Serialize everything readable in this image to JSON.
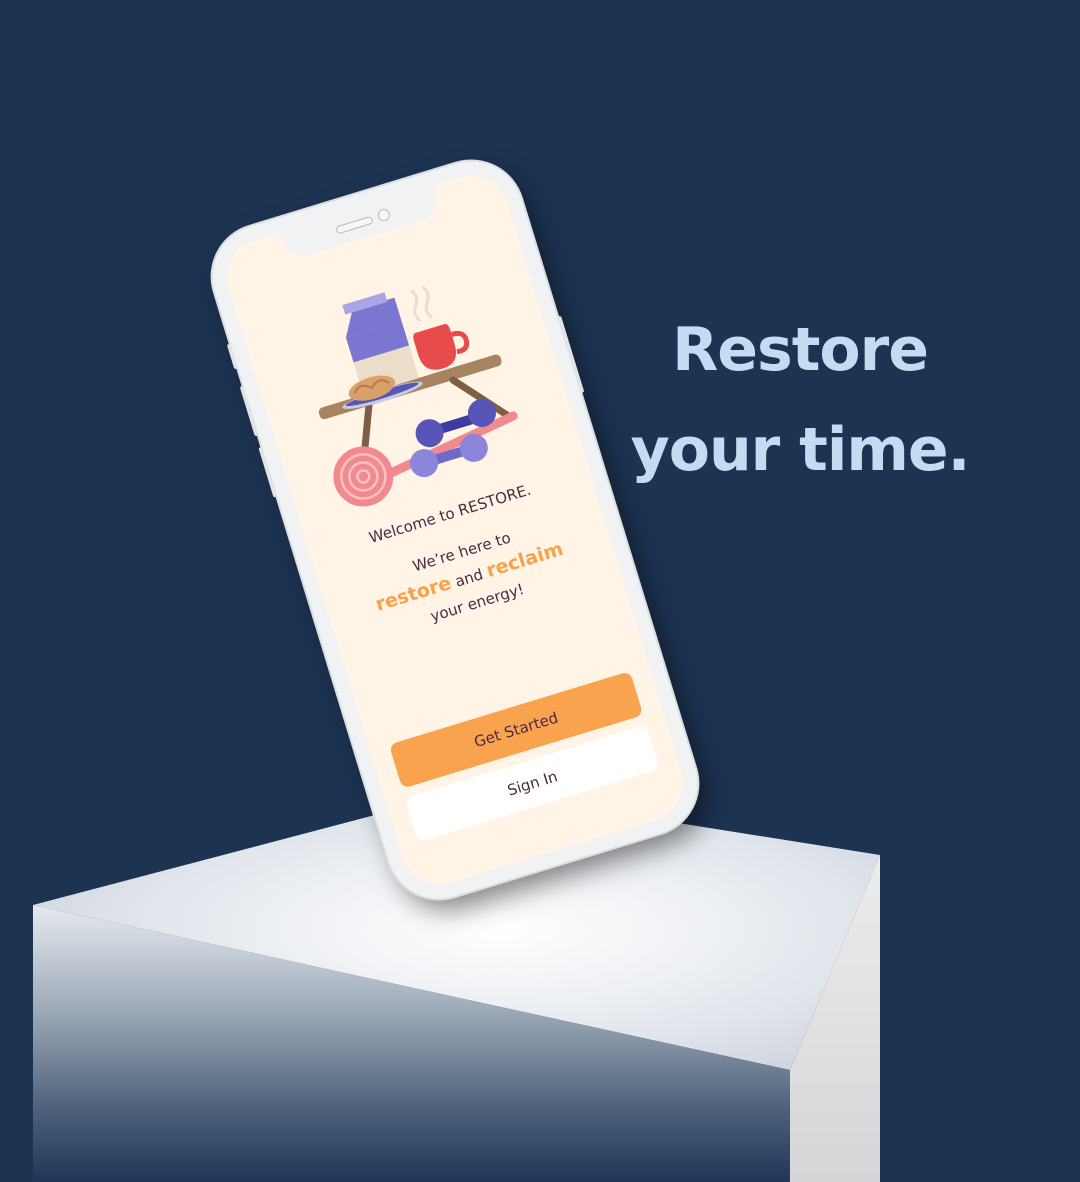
{
  "headline": {
    "line1": "Restore",
    "line2": "your time."
  },
  "app": {
    "welcome": "Welcome to RESTORE.",
    "tagline_intro": "We’re here to",
    "highlight_restore": "restore",
    "connector": "and",
    "highlight_reclaim": "reclaim",
    "tagline_end": "your energy!",
    "get_started_label": "Get Started",
    "sign_in_label": "Sign In"
  },
  "colors": {
    "background": "#1c3352",
    "headline": "#c4dbf2",
    "screen": "#fff4e5",
    "accent": "#f9a14b",
    "text": "#4a2a43"
  },
  "icons": [
    "milk-carton-icon",
    "coffee-cup-icon",
    "croissant-icon",
    "table-icon",
    "yoga-mat-icon",
    "dumbbell-icon"
  ]
}
